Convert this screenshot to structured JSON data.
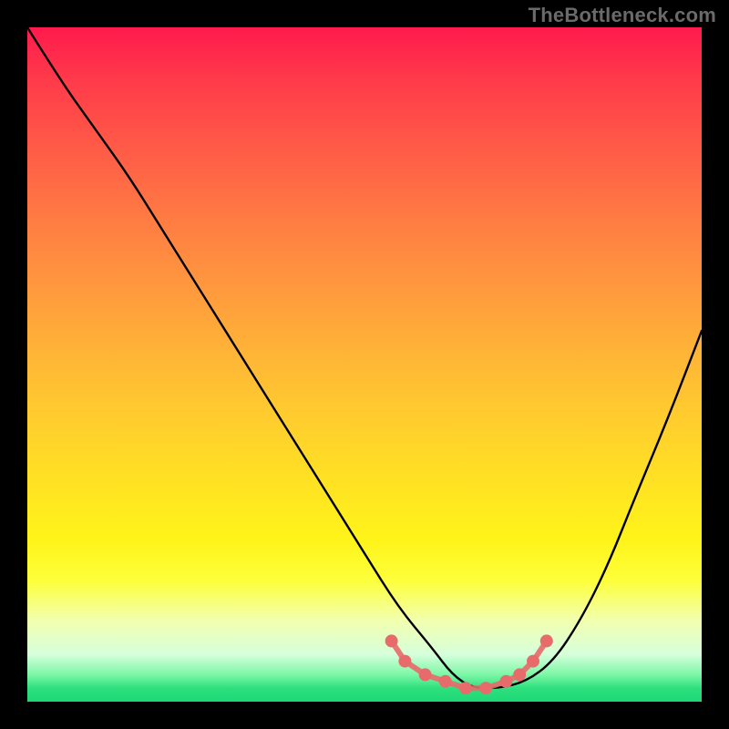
{
  "watermark": "TheBottleneck.com",
  "chart_data": {
    "type": "line",
    "title": "",
    "xlabel": "",
    "ylabel": "",
    "xlim": [
      0,
      100
    ],
    "ylim": [
      0,
      100
    ],
    "grid": false,
    "legend": false,
    "series": [
      {
        "name": "bottleneck-curve",
        "x": [
          0,
          5,
          10,
          15,
          20,
          25,
          30,
          35,
          40,
          45,
          50,
          55,
          60,
          63,
          66,
          70,
          74,
          78,
          82,
          86,
          90,
          95,
          100
        ],
        "y": [
          100,
          92,
          85,
          78,
          70,
          62,
          54,
          46,
          38,
          30,
          22,
          14,
          8,
          4,
          2,
          2,
          3,
          6,
          12,
          20,
          30,
          42,
          55
        ]
      },
      {
        "name": "optimal-zone-markers",
        "x": [
          54,
          56,
          59,
          62,
          65,
          68,
          71,
          73,
          75,
          77
        ],
        "y": [
          9,
          6,
          4,
          3,
          2,
          2,
          3,
          4,
          6,
          9
        ]
      }
    ],
    "colors": {
      "curve": "#000000",
      "markers": "#e86b6b",
      "gradient_top": "#ff1a4d",
      "gradient_bottom": "#1ed876"
    }
  }
}
